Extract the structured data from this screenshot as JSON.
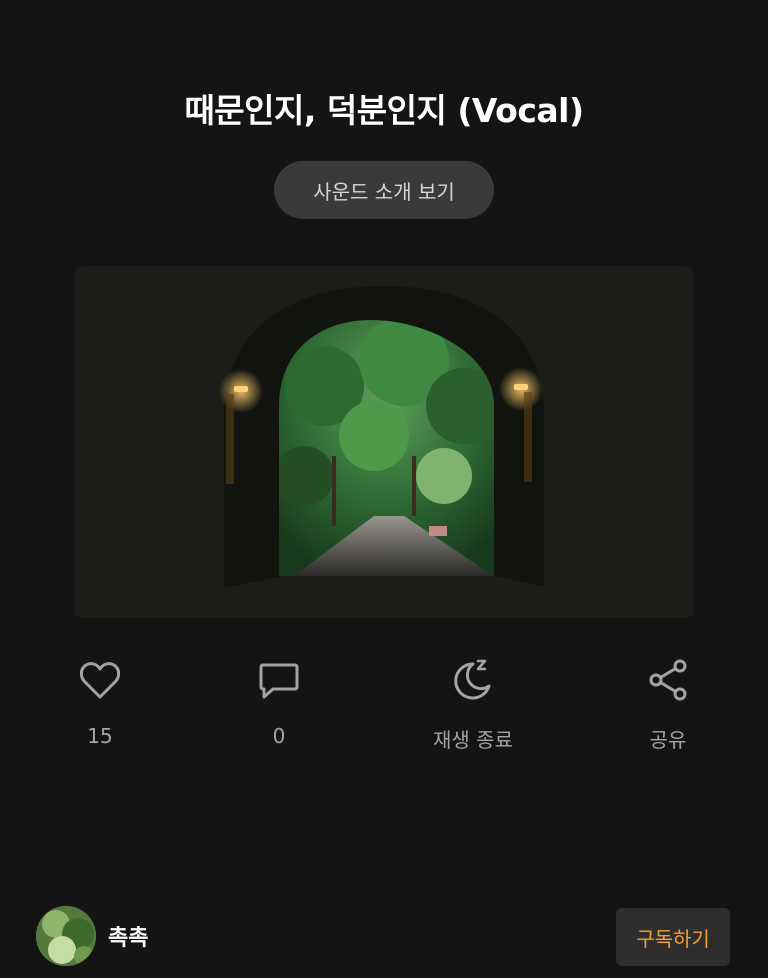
{
  "track": {
    "title": "때문인지, 덕분인지 (Vocal)",
    "intro_button_label": "사운드 소개 보기"
  },
  "actions": {
    "like": {
      "icon": "heart-icon",
      "count": "15"
    },
    "comment": {
      "icon": "comment-icon",
      "count": "0"
    },
    "sleep_timer": {
      "icon": "moon-sleep-icon",
      "label": "재생 종료"
    },
    "share": {
      "icon": "share-icon",
      "label": "공유"
    }
  },
  "creator": {
    "name": "촉촉",
    "subscribe_label": "구독하기"
  },
  "colors": {
    "background": "#141414",
    "accent": "#f2a233",
    "icon": "#a4a4a4"
  }
}
